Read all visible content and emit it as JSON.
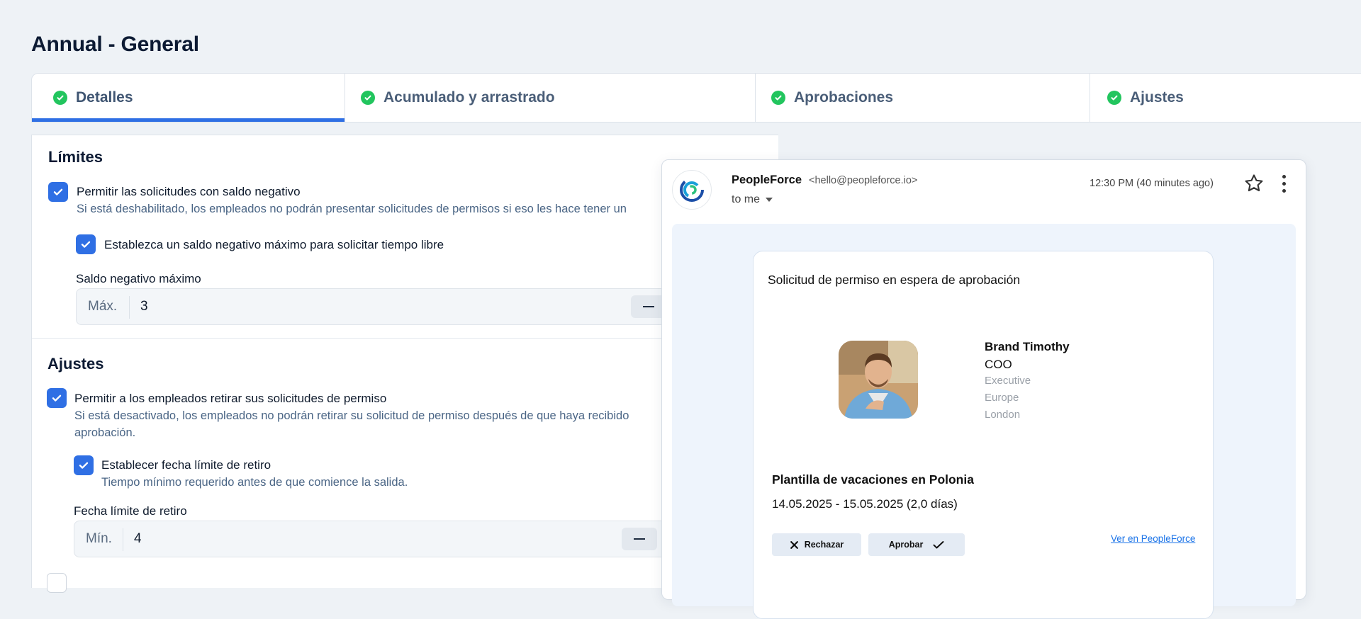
{
  "page_title": "Annual - General",
  "tabs": [
    {
      "label": "Detalles",
      "active": true
    },
    {
      "label": "Acumulado y arrastrado",
      "active": false
    },
    {
      "label": "Aprobaciones",
      "active": false
    },
    {
      "label": "Ajustes",
      "active": false
    }
  ],
  "limits": {
    "title": "Límites",
    "negative_balance": {
      "label": "Permitir las solicitudes con saldo negativo",
      "help": "Si está deshabilitado, los empleados no podrán presentar solicitudes de permisos si eso les hace tener un",
      "checked": true
    },
    "max_negative": {
      "label": "Establezca un saldo negativo máximo para solicitar tiempo libre",
      "checked": true
    },
    "max_field": {
      "label": "Saldo negativo máximo",
      "prefix": "Máx.",
      "value": "3"
    }
  },
  "settings": {
    "title": "Ajustes",
    "withdraw": {
      "label": "Permitir a los empleados retirar sus solicitudes de permiso",
      "help_line1": "Si está desactivado, los empleados no podrán retirar su solicitud de permiso después de que haya recibido",
      "help_line2": "aprobación.",
      "checked": true
    },
    "deadline": {
      "label": "Establecer fecha límite de retiro",
      "help": "Tiempo mínimo requerido antes de que comience la salida.",
      "checked": true
    },
    "deadline_field": {
      "label": "Fecha límite de retiro",
      "prefix": "Mín.",
      "value": "4"
    }
  },
  "email": {
    "sender_name": "PeopleForce",
    "sender_email": "<hello@peopleforce.io>",
    "to": "to me",
    "time": "12:30 PM (40 minutes ago)",
    "card": {
      "title": "Solicitud de permiso en espera de aprobación",
      "person": {
        "name": "Brand Timothy",
        "role": "COO",
        "level": "Executive",
        "region": "Europe",
        "city": "London"
      },
      "policy": "Plantilla de vacaciones en Polonia",
      "dates": "14.05.2025 - 15.05.2025 (2,0 días)",
      "reject_label": "Rechazar",
      "approve_label": "Aprobar",
      "link_label": "Ver en PeopleForce"
    }
  },
  "colors": {
    "accent": "#2f6fe4",
    "success": "#22c55e",
    "link": "#1a73e8"
  }
}
